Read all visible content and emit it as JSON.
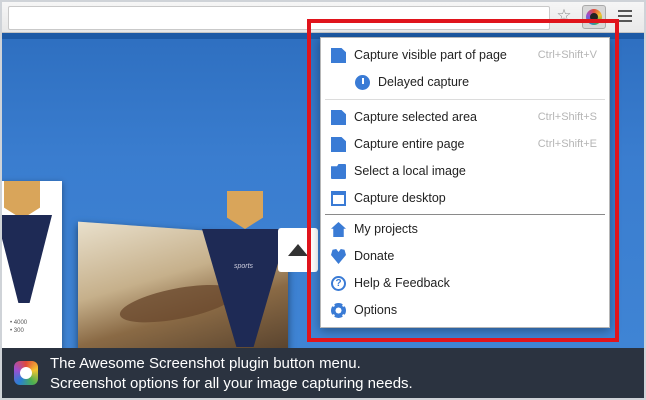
{
  "menu": {
    "items": [
      {
        "label": "Capture visible part of page",
        "shortcut": "Ctrl+Shift+V",
        "icon": "page-icon"
      },
      {
        "label": "Delayed capture",
        "shortcut": "",
        "icon": "clock-icon"
      },
      {
        "label": "Capture selected area",
        "shortcut": "Ctrl+Shift+S",
        "icon": "page-icon"
      },
      {
        "label": "Capture entire page",
        "shortcut": "Ctrl+Shift+E",
        "icon": "page-icon"
      },
      {
        "label": "Select a local image",
        "shortcut": "",
        "icon": "folder-icon"
      },
      {
        "label": "Capture desktop",
        "shortcut": "",
        "icon": "desktop-icon"
      },
      {
        "label": "My projects",
        "shortcut": "",
        "icon": "home-icon"
      },
      {
        "label": "Donate",
        "shortcut": "",
        "icon": "heart-icon"
      },
      {
        "label": "Help & Feedback",
        "shortcut": "",
        "icon": "help-icon"
      },
      {
        "label": "Options",
        "shortcut": "",
        "icon": "gear-icon"
      }
    ]
  },
  "caption": {
    "line1": "The Awesome Screenshot plugin button menu.",
    "line2": "Screenshot options for all your image capturing needs."
  },
  "site": {
    "jersey_text": "sports",
    "small_card_lines": [
      "• 4000",
      "• 300"
    ]
  },
  "colors": {
    "accent": "#3a7bd5",
    "highlight": "#e0141c",
    "caption_bg": "#2b3340"
  }
}
